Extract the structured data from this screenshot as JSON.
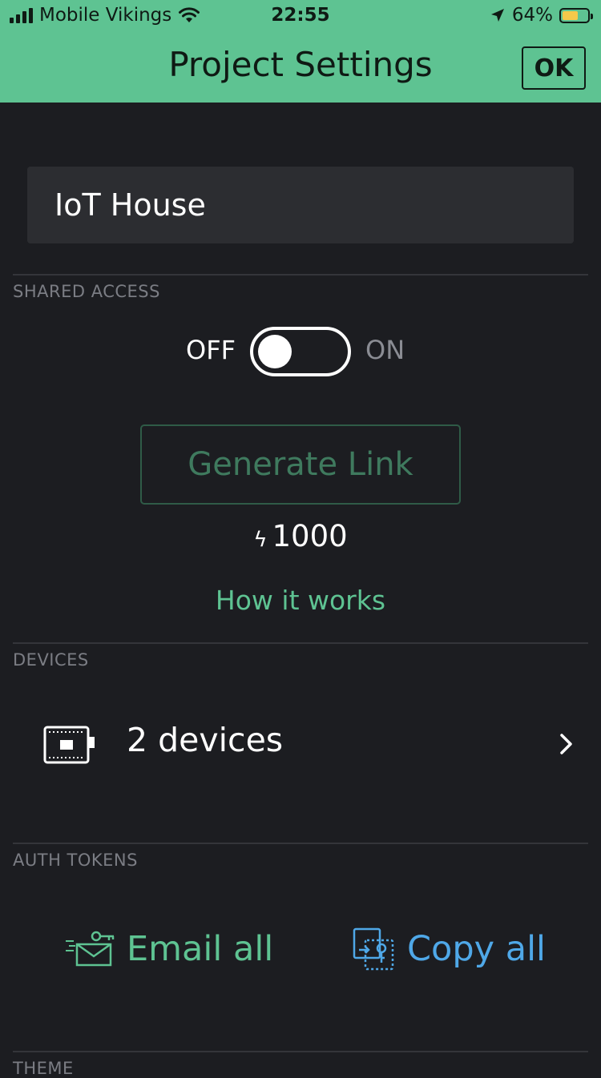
{
  "status_bar": {
    "carrier": "Mobile Vikings",
    "time": "22:55",
    "battery_percent": "64%",
    "battery_level": 0.64,
    "icons": [
      "signal-icon",
      "wifi-icon",
      "location-icon",
      "battery-icon"
    ]
  },
  "header": {
    "title": "Project Settings",
    "ok_label": "OK"
  },
  "project": {
    "name": "IoT House"
  },
  "shared_access": {
    "section_label": "SHARED ACCESS",
    "toggle_off_label": "OFF",
    "toggle_on_label": "ON",
    "toggle_state": "off",
    "generate_link_label": "Generate Link",
    "energy_value": "1000",
    "energy_icon": "bolt-icon",
    "how_it_works_label": "How it works"
  },
  "devices": {
    "section_label": "DEVICES",
    "count_label": "2 devices",
    "icon": "device-board-icon"
  },
  "auth_tokens": {
    "section_label": "AUTH TOKENS",
    "email_all_label": "Email all",
    "copy_all_label": "Copy all"
  },
  "theme": {
    "section_label": "THEME"
  },
  "colors": {
    "accent_green": "#5ec392",
    "accent_blue": "#4fa8e8",
    "background": "#1c1d21",
    "field_background": "#2c2d31"
  }
}
